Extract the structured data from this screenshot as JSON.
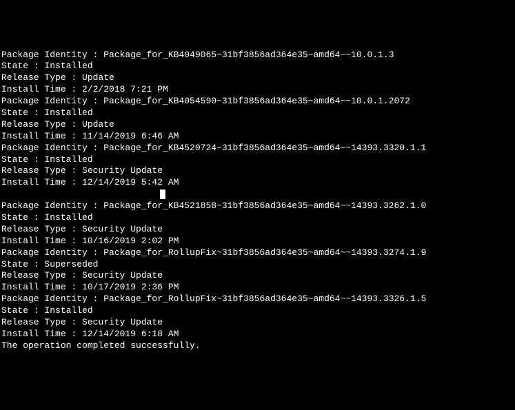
{
  "packages": [
    {
      "identity": "Package_for_KB4049065~31bf3856ad364e35~amd64~~10.0.1.3",
      "state": "Installed",
      "release_type": "Update",
      "install_time": "2/2/2018 7:21 PM"
    },
    {
      "identity": "Package_for_KB4054590~31bf3856ad364e35~amd64~~10.0.1.2072",
      "state": "Installed",
      "release_type": "Update",
      "install_time": "11/14/2019 6:46 AM"
    },
    {
      "identity": "Package_for_KB4520724~31bf3856ad364e35~amd64~~14393.3320.1.1",
      "state": "Installed",
      "release_type": "Security Update",
      "install_time": "12/14/2019 5:42 AM"
    },
    {
      "identity": "Package_for_KB4521858~31bf3856ad364e35~amd64~~14393.3262.1.0",
      "state": "Installed",
      "release_type": "Security Update",
      "install_time": "10/16/2019 2:02 PM"
    },
    {
      "identity": "Package_for_RollupFix~31bf3856ad364e35~amd64~~14393.3274.1.9",
      "state": "Superseded",
      "release_type": "Security Update",
      "install_time": "10/17/2019 2:36 PM"
    },
    {
      "identity": "Package_for_RollupFix~31bf3856ad364e35~amd64~~14393.3326.1.5",
      "state": "Installed",
      "release_type": "Security Update",
      "install_time": "12/14/2019 6:18 AM"
    }
  ],
  "labels": {
    "package_identity": "Package Identity : ",
    "state": "State : ",
    "release_type": "Release Type : ",
    "install_time": "Install Time : "
  },
  "footer": "The operation completed successfully."
}
